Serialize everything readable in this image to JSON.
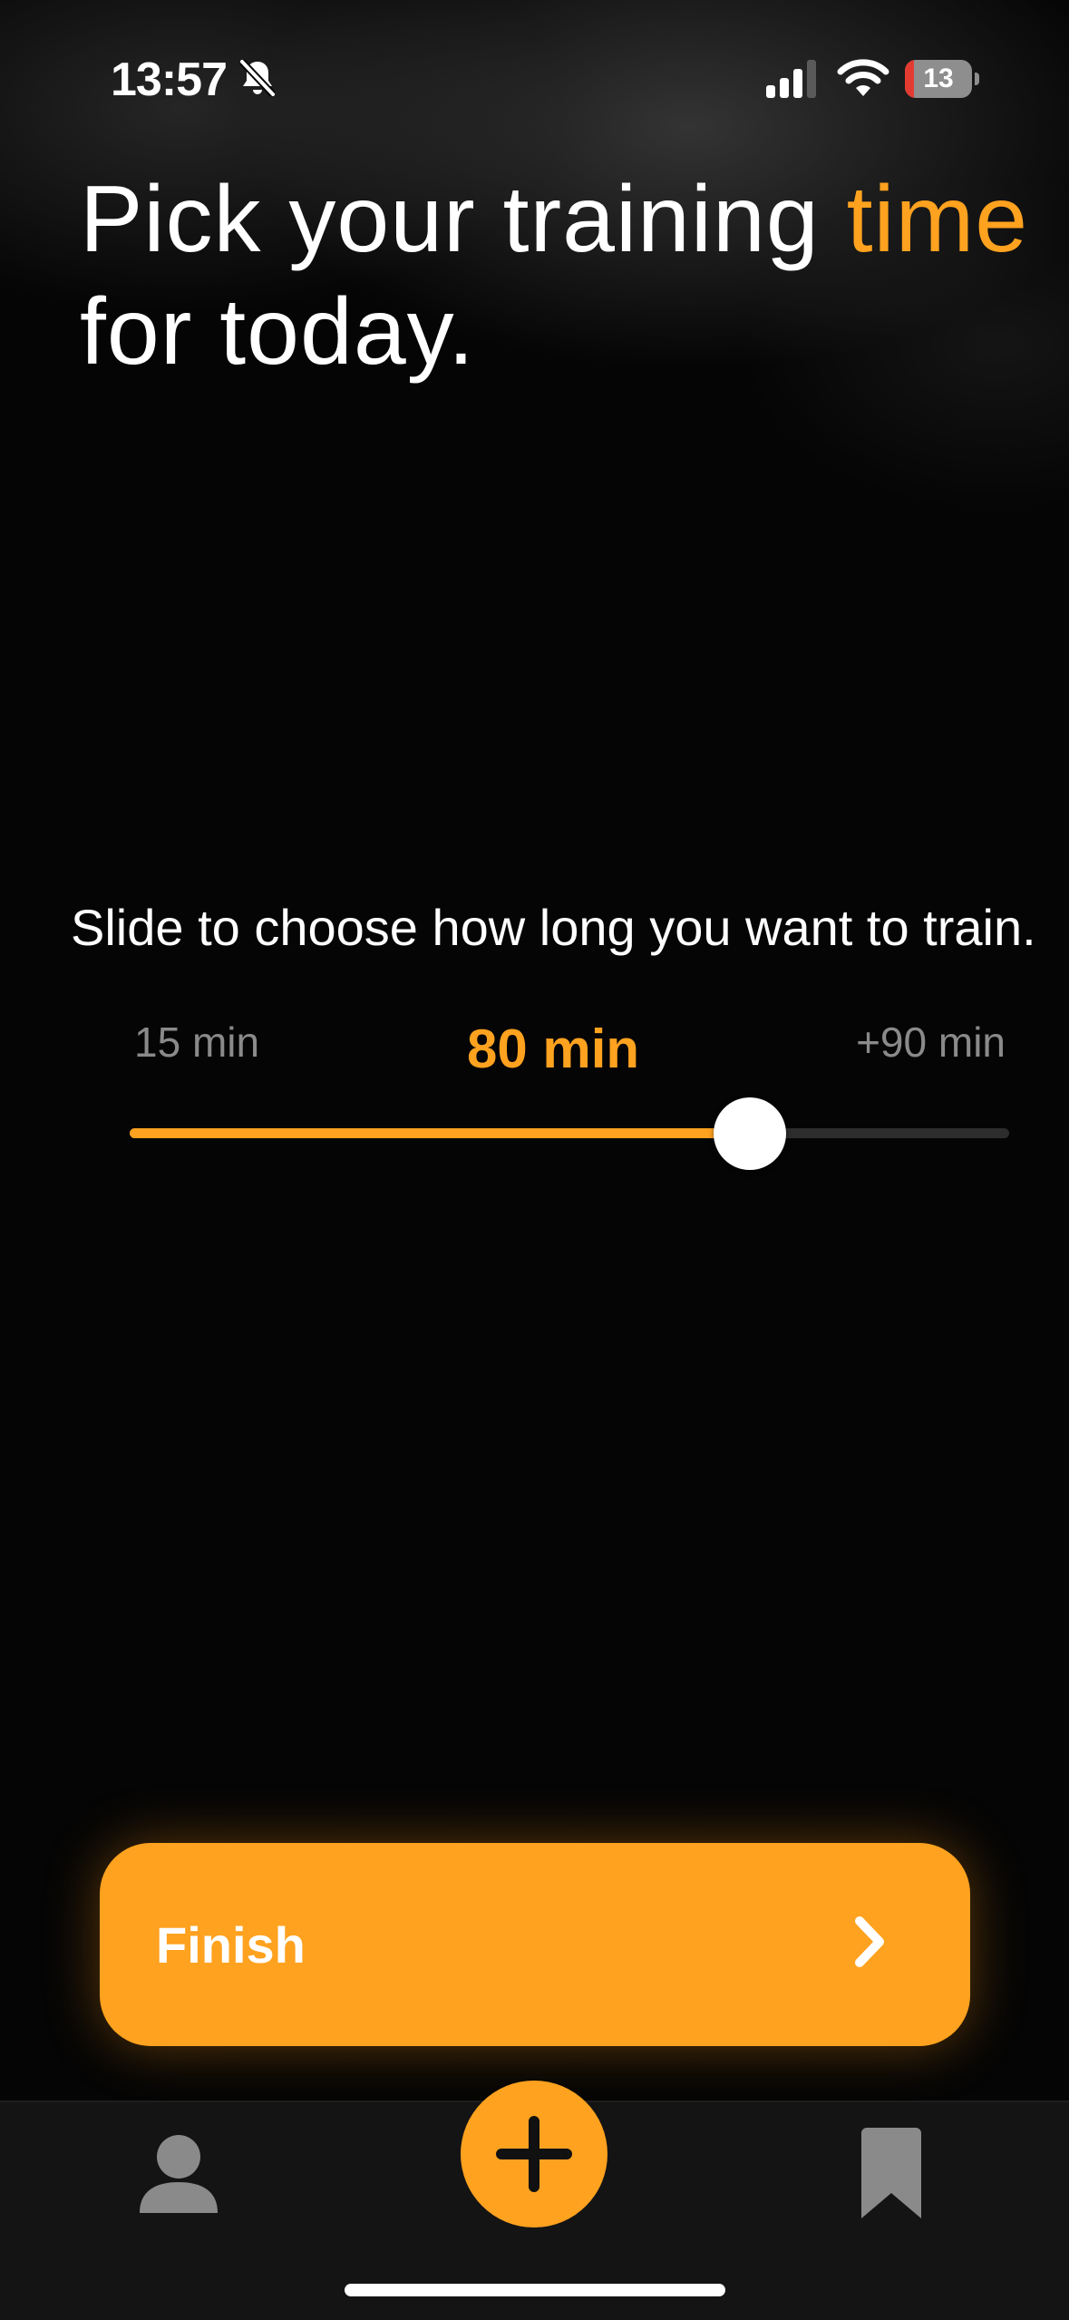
{
  "status_bar": {
    "time": "13:57",
    "battery_level": "13",
    "icons": [
      "bell-slash-icon",
      "cellular-signal-icon",
      "wifi-icon",
      "battery-icon"
    ]
  },
  "headline": {
    "text_before": "Pick your training ",
    "accent_word": "time",
    "text_after": " for today."
  },
  "instruction": "Slide to choose how long you want to train.",
  "slider": {
    "min_label": "15 min",
    "value_label": "80 min",
    "max_label": "+90 min",
    "fill_fraction": 0.705
  },
  "finish_button": {
    "label": "Finish",
    "icon": "chevron-right-icon"
  },
  "tab_bar": {
    "items": [
      {
        "name": "profile",
        "icon": "person-icon"
      },
      {
        "name": "add",
        "icon": "plus-icon"
      },
      {
        "name": "saved",
        "icon": "bookmark-icon"
      }
    ]
  },
  "colors": {
    "accent": "#ffa21f",
    "background": "#050505",
    "track": "#2d2d2d",
    "tab_bar": "#141414",
    "muted_text": "#8a8a8a",
    "battery_low": "#e33b31"
  }
}
